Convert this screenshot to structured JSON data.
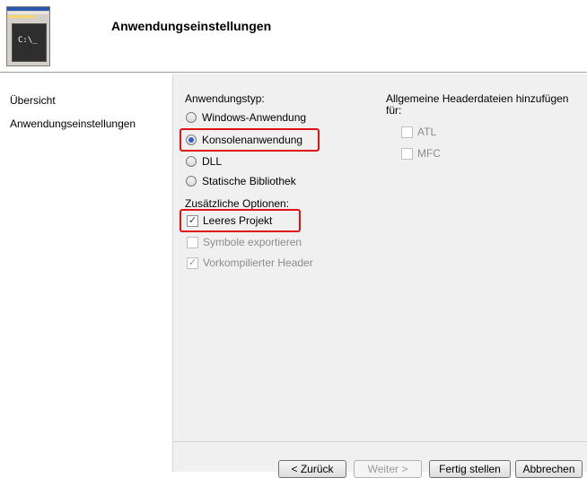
{
  "header": {
    "title": "Anwendungseinstellungen",
    "thumbnail_text": "C:\\_"
  },
  "nav": {
    "items": [
      "Übersicht",
      "Anwendungseinstellungen"
    ]
  },
  "app_type": {
    "heading": "Anwendungstyp:",
    "options": [
      {
        "label": "Windows-Anwendung",
        "selected": false
      },
      {
        "label": "Konsolenanwendung",
        "selected": true
      },
      {
        "label": "DLL",
        "selected": false
      },
      {
        "label": "Statische Bibliothek",
        "selected": false
      }
    ]
  },
  "extra_options": {
    "heading": "Zusätzliche Optionen:",
    "items": [
      {
        "label": "Leeres Projekt",
        "checked": true,
        "enabled": true
      },
      {
        "label": "Symbole exportieren",
        "checked": false,
        "enabled": false
      },
      {
        "label": "Vorkompilierter Header",
        "checked": true,
        "enabled": false
      }
    ]
  },
  "headers": {
    "heading_line1": "Allgemeine Headerdateien hinzufügen",
    "heading_line2": "für:",
    "items": [
      {
        "label": "ATL",
        "checked": false,
        "enabled": false
      },
      {
        "label": "MFC",
        "checked": false,
        "enabled": false
      }
    ]
  },
  "buttons": {
    "back": "< Zurück",
    "next": "Weiter >",
    "finish": "Fertig stellen",
    "cancel": "Abbrechen"
  },
  "colors": {
    "highlight": "#e01414",
    "panel_bg": "#f0f0f0"
  }
}
